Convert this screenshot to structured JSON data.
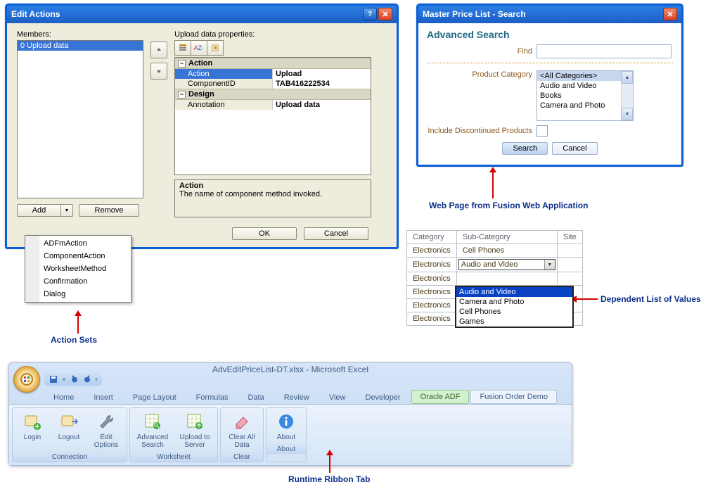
{
  "edit_actions": {
    "title": "Edit Actions",
    "members_label": "Members:",
    "members_item": "0  Upload data",
    "upload_props_label": "Upload data properties:",
    "groups": {
      "action": "Action",
      "design": "Design"
    },
    "props": {
      "action_key": "Action",
      "action_val": "Upload",
      "comp_key": "ComponentID",
      "comp_val": "TAB416222534",
      "anno_key": "Annotation",
      "anno_val": "Upload data"
    },
    "desc_title": "Action",
    "desc_body": "The name of component method invoked.",
    "add_label": "Add",
    "remove_label": "Remove",
    "ok_label": "OK",
    "cancel_label": "Cancel",
    "menu": [
      "ADFmAction",
      "ComponentAction",
      "WorksheetMethod",
      "Confirmation",
      "Dialog"
    ]
  },
  "search": {
    "title": "Master Price List - Search",
    "heading": "Advanced Search",
    "find_label": "Find",
    "cat_label": "Product Category",
    "list": [
      "<All Categories>",
      "Audio and Video",
      "Books",
      "Camera and Photo"
    ],
    "discontinued_label": "Include Discontinued Products",
    "search_btn": "Search",
    "cancel_btn": "Cancel"
  },
  "table": {
    "headers": [
      "Category",
      "Sub-Category",
      "Site"
    ],
    "cat_val": "Electronics",
    "sub1": "Cell Phones",
    "sub_dd": "Audio and Video",
    "sub4": "Audio and Video",
    "dd_items": [
      "Audio and Video",
      "Camera and Photo",
      "Cell Phones",
      "Games"
    ]
  },
  "ribbon": {
    "filename": "AdvEditPriceList-DT.xlsx - Microsoft Excel",
    "tabs": [
      "Home",
      "Insert",
      "Page Layout",
      "Formulas",
      "Data",
      "Review",
      "View",
      "Developer",
      "Oracle ADF",
      "Fusion Order Demo"
    ],
    "groups": {
      "connection": {
        "label": "Connection",
        "items": [
          "Login",
          "Logout",
          "Edit Options"
        ]
      },
      "worksheet": {
        "label": "Worksheet",
        "items": [
          "Advanced Search",
          "Upload to Server"
        ]
      },
      "clear": {
        "label": "Clear",
        "items": [
          "Clear All Data"
        ]
      },
      "about": {
        "label": "About",
        "items": [
          "About"
        ]
      }
    }
  },
  "captions": {
    "action_sets": "Action Sets",
    "web_page": "Web Page from Fusion Web Application",
    "dep_lov": "Dependent List of Values",
    "ribbon_tab": "Runtime Ribbon Tab"
  }
}
